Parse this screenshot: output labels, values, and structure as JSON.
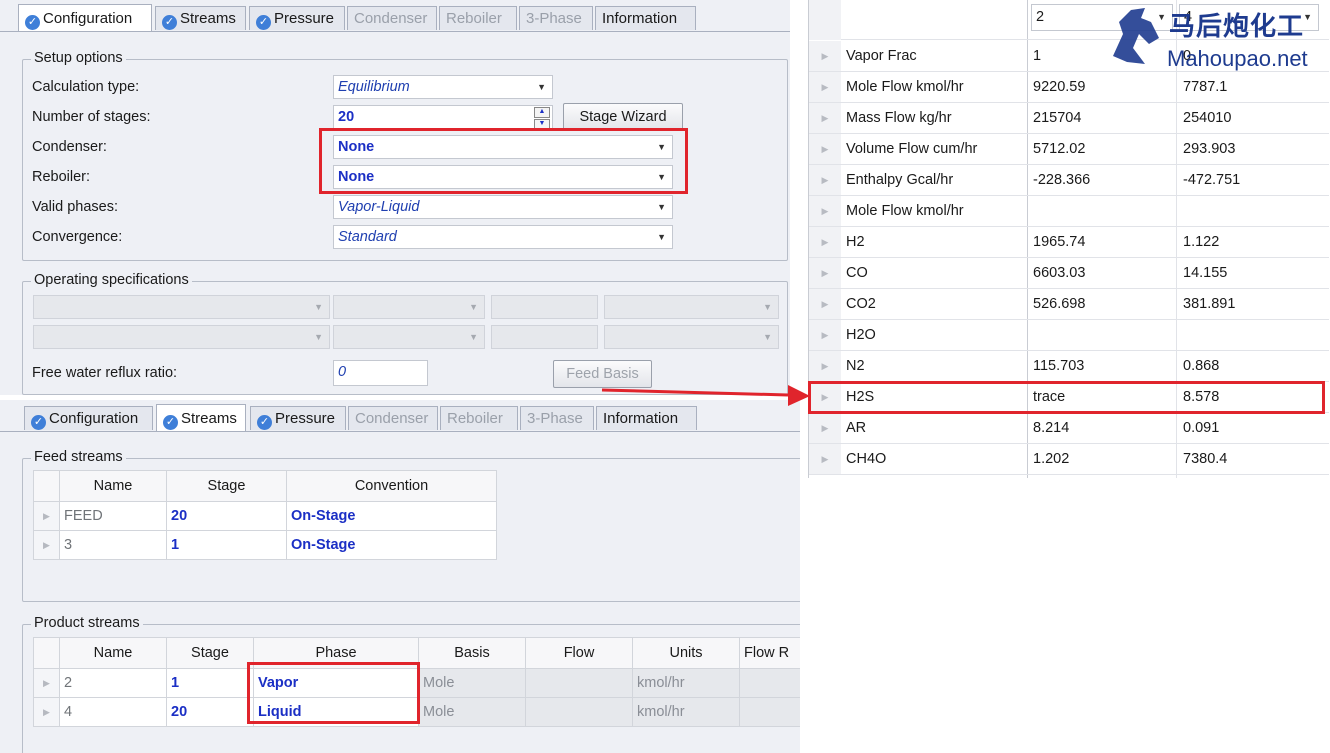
{
  "tabs_top": [
    {
      "label": "Configuration",
      "checked": true,
      "active": true
    },
    {
      "label": "Streams",
      "checked": true
    },
    {
      "label": "Pressure",
      "checked": true
    },
    {
      "label": "Condenser",
      "disabled": true
    },
    {
      "label": "Reboiler",
      "disabled": true
    },
    {
      "label": "3-Phase",
      "disabled": true
    },
    {
      "label": "Information"
    }
  ],
  "setup": {
    "title": "Setup options",
    "calc_type_label": "Calculation type:",
    "calc_type_value": "Equilibrium",
    "stages_label": "Number of stages:",
    "stages_value": "20",
    "stage_wizard": "Stage Wizard",
    "condenser_label": "Condenser:",
    "condenser_value": "None",
    "reboiler_label": "Reboiler:",
    "reboiler_value": "None",
    "phases_label": "Valid phases:",
    "phases_value": "Vapor-Liquid",
    "convergence_label": "Convergence:",
    "convergence_value": "Standard"
  },
  "operating": {
    "title": "Operating specifications",
    "free_water_label": "Free water reflux ratio:",
    "free_water_value": "0",
    "feed_basis": "Feed Basis"
  },
  "tabs_bottom": [
    {
      "label": "Configuration",
      "checked": true
    },
    {
      "label": "Streams",
      "checked": true,
      "active": true
    },
    {
      "label": "Pressure",
      "checked": true
    },
    {
      "label": "Condenser",
      "disabled": true
    },
    {
      "label": "Reboiler",
      "disabled": true
    },
    {
      "label": "3-Phase",
      "disabled": true
    },
    {
      "label": "Information"
    }
  ],
  "feed_streams": {
    "title": "Feed streams",
    "headers": [
      "Name",
      "Stage",
      "Convention"
    ],
    "rows": [
      [
        "FEED",
        "20",
        "On-Stage"
      ],
      [
        "3",
        "1",
        "On-Stage"
      ]
    ]
  },
  "product_streams": {
    "title": "Product streams",
    "headers": [
      "Name",
      "Stage",
      "Phase",
      "Basis",
      "Flow",
      "Units",
      "Flow R"
    ],
    "rows": [
      [
        "2",
        "1",
        "Vapor",
        "Mole",
        "",
        "kmol/hr",
        ""
      ],
      [
        "4",
        "20",
        "Liquid",
        "Mole",
        "",
        "kmol/hr",
        ""
      ]
    ]
  },
  "results": {
    "header_cols": [
      "2",
      "4"
    ],
    "rows": [
      [
        "Vapor Frac",
        "1",
        "0"
      ],
      [
        "Mole Flow kmol/hr",
        "9220.59",
        "7787.1"
      ],
      [
        "Mass Flow kg/hr",
        "215704",
        "254010"
      ],
      [
        "Volume Flow cum/hr",
        "5712.02",
        "293.903"
      ],
      [
        "Enthalpy    Gcal/hr",
        "-228.366",
        "-472.751"
      ],
      [
        "Mole Flow kmol/hr",
        "",
        ""
      ],
      [
        "H2",
        "1965.74",
        "1.122"
      ],
      [
        "CO",
        "6603.03",
        "14.155"
      ],
      [
        "CO2",
        "526.698",
        "381.891"
      ],
      [
        "H2O",
        "",
        ""
      ],
      [
        "N2",
        "115.703",
        "0.868"
      ],
      [
        "H2S",
        "trace",
        "8.578"
      ],
      [
        "AR",
        "8.214",
        "0.091"
      ],
      [
        "CH4O",
        "1.202",
        "7380.4"
      ]
    ]
  },
  "watermark": {
    "cn": "马后炮化工",
    "en": "Mahoupao.net"
  },
  "colors": {
    "highlight": "#e0242c",
    "accent_blue": "#1b2fc5",
    "tab_check": "#3f7fd8"
  }
}
